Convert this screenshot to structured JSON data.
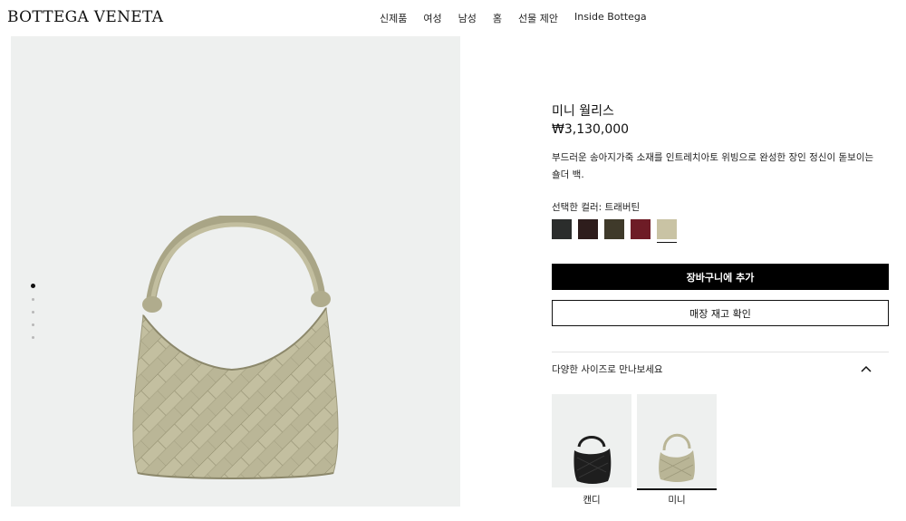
{
  "header": {
    "logo": "BOTTEGA VENETA",
    "nav": [
      "신제품",
      "여성",
      "남성",
      "홈",
      "선물 제안",
      "Inside Bottega"
    ]
  },
  "product": {
    "name": "미니 월리스",
    "price": "₩3,130,000",
    "description": "부드러운 송아지가죽 소재를 인트레치아토 위빙으로 완성한 장인 정신이 돋보이는 숄더 백.",
    "color_label": "선택한 컬러: 트래버틴",
    "swatches": [
      "#2b2d2c",
      "#2e1d1c",
      "#3f3a2a",
      "#6e1c26",
      "#c9c3a4"
    ],
    "selected_swatch": 4
  },
  "actions": {
    "add_to_cart": "장바구니에 추가",
    "check_store": "매장 재고 확인"
  },
  "sizes": {
    "header": "다양한 사이즈로 만나보세요",
    "items": [
      {
        "label": "캔디",
        "color": "#1e1e1e"
      },
      {
        "label": "미니",
        "color": "#b9b596"
      }
    ],
    "selected": 1
  },
  "gallery": {
    "slide_count": 5,
    "active_slide": 0,
    "bag_color": "#b9b596"
  }
}
